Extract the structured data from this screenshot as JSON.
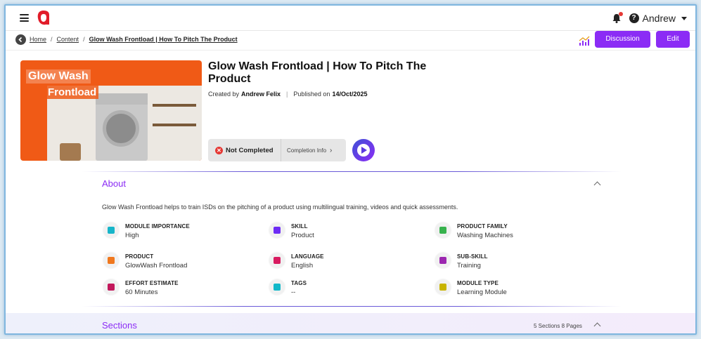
{
  "header": {
    "username": "Andrew"
  },
  "breadcrumb": {
    "home": "Home",
    "content": "Content",
    "current": "Glow Wash Frontload | How To Pitch The Product"
  },
  "actions": {
    "discussion": "Discussion",
    "edit": "Edit"
  },
  "course": {
    "thumbnail_line1": "Glow Wash",
    "thumbnail_line2": "Frontload",
    "title": "Glow Wash Frontload | How To Pitch The Product",
    "created_by_label": "Created by",
    "author": "Andrew Felix",
    "published_label": "Published on",
    "published_date": "14/Oct/2025",
    "status": "Not Completed",
    "completion_info": "Completion Info"
  },
  "about": {
    "title": "About",
    "description": "Glow Wash Frontload helps to train ISDs on the pitching of a product using multilingual training, videos and quick assessments.",
    "attributes": [
      {
        "label": "MODULE IMPORTANCE",
        "value": "High",
        "icon": "gauge-icon",
        "color": "#17b5c9"
      },
      {
        "label": "SKILL",
        "value": "Product",
        "icon": "tools-icon",
        "color": "#6d2cf5"
      },
      {
        "label": "PRODUCT FAMILY",
        "value": "Washing Machines",
        "icon": "grid-icon",
        "color": "#37b24d"
      },
      {
        "label": "PRODUCT",
        "value": "GlowWash Frontload",
        "icon": "list-icon",
        "color": "#f0781e"
      },
      {
        "label": "LANGUAGE",
        "value": "English",
        "icon": "translate-icon",
        "color": "#d81b60"
      },
      {
        "label": "SUB-SKILL",
        "value": "Training",
        "icon": "network-icon",
        "color": "#9c27b0"
      },
      {
        "label": "EFFORT ESTIMATE",
        "value": "60 Minutes",
        "icon": "hourglass-icon",
        "color": "#c2185b"
      },
      {
        "label": "TAGS",
        "value": "--",
        "icon": "tag-icon",
        "color": "#12b8c9"
      },
      {
        "label": "MODULE TYPE",
        "value": "Learning Module",
        "icon": "shapes-icon",
        "color": "#c8b400"
      }
    ]
  },
  "sections": {
    "title": "Sections",
    "count": "5 Sections  8 Pages"
  },
  "colors": {
    "accent": "#8b2cf5",
    "brand": "#e11d2a",
    "status_error": "#e53935"
  }
}
